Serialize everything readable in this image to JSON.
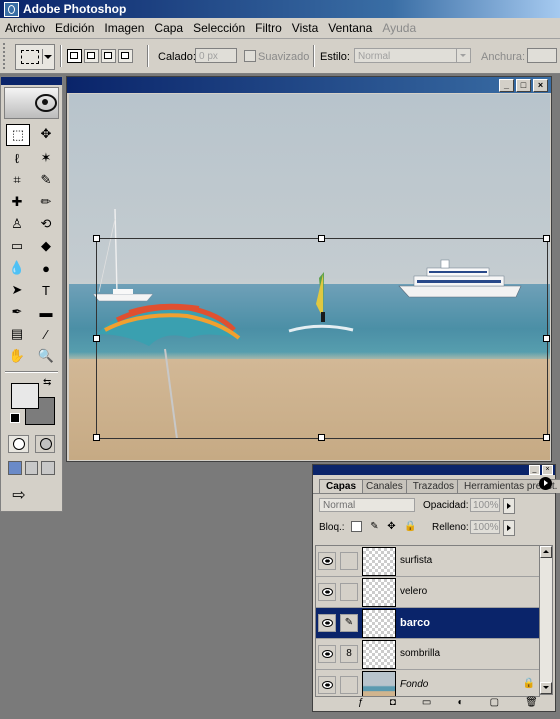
{
  "app": {
    "title": "Adobe Photoshop"
  },
  "menu": [
    "Archivo",
    "Edición",
    "Imagen",
    "Capa",
    "Selección",
    "Filtro",
    "Vista",
    "Ventana",
    "Ayuda"
  ],
  "options": {
    "feather_label": "Calado:",
    "feather_value": "0 px",
    "antialias_label": "Suavizado",
    "style_label": "Estilo:",
    "style_value": "Normal",
    "width_label": "Anchura:"
  },
  "toolbox": {
    "tools": [
      {
        "name": "marquee-tool-icon",
        "glyph": "⬚",
        "active": true
      },
      {
        "name": "move-tool-icon",
        "glyph": "✥"
      },
      {
        "name": "lasso-tool-icon",
        "glyph": "ℓ"
      },
      {
        "name": "magic-wand-icon",
        "glyph": "✶"
      },
      {
        "name": "crop-tool-icon",
        "glyph": "⌗"
      },
      {
        "name": "slice-tool-icon",
        "glyph": "✎"
      },
      {
        "name": "healing-brush-icon",
        "glyph": "✚"
      },
      {
        "name": "brush-tool-icon",
        "glyph": "✏"
      },
      {
        "name": "clone-stamp-icon",
        "glyph": "♙"
      },
      {
        "name": "history-brush-icon",
        "glyph": "⟲"
      },
      {
        "name": "eraser-tool-icon",
        "glyph": "▭"
      },
      {
        "name": "paint-bucket-icon",
        "glyph": "◆"
      },
      {
        "name": "blur-tool-icon",
        "glyph": "💧"
      },
      {
        "name": "dodge-tool-icon",
        "glyph": "●"
      },
      {
        "name": "path-select-icon",
        "glyph": "➤"
      },
      {
        "name": "type-tool-icon",
        "glyph": "T"
      },
      {
        "name": "pen-tool-icon",
        "glyph": "✒"
      },
      {
        "name": "rectangle-tool-icon",
        "glyph": "▬"
      },
      {
        "name": "notes-tool-icon",
        "glyph": "▤"
      },
      {
        "name": "eyedropper-icon",
        "glyph": "⁄"
      },
      {
        "name": "hand-tool-icon",
        "glyph": "✋"
      },
      {
        "name": "zoom-tool-icon",
        "glyph": "🔍"
      }
    ]
  },
  "layers_panel": {
    "tabs": [
      "Capas",
      "Canales",
      "Trazados",
      "Herramientas preest."
    ],
    "blend_mode": "Normal",
    "opacity_label": "Opacidad:",
    "opacity_value": "100%",
    "lock_label": "Bloq.:",
    "fill_label": "Relleno:",
    "fill_value": "100%",
    "layers": [
      {
        "name": "surfista",
        "selected": false,
        "link": ""
      },
      {
        "name": "velero",
        "selected": false,
        "link": ""
      },
      {
        "name": "barco",
        "selected": true,
        "link": "brush"
      },
      {
        "name": "sombrilla",
        "selected": false,
        "link": "chain"
      },
      {
        "name": "Fondo",
        "selected": false,
        "link": "",
        "italic": true,
        "locked": true
      }
    ]
  }
}
